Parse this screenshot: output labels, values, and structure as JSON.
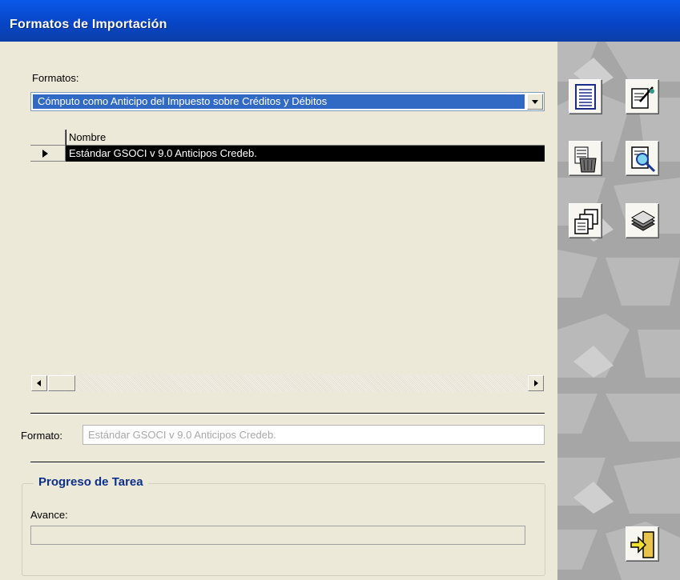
{
  "window": {
    "title": "Formatos de Importación"
  },
  "formatos": {
    "label": "Formatos:",
    "selected": "Cómputo como Anticipo del Impuesto sobre Créditos y Débitos"
  },
  "grid": {
    "column_header": "Nombre",
    "rows": [
      {
        "nombre": "Estándar GSOCI v 9.0 Anticipos Credeb."
      }
    ]
  },
  "formato": {
    "label": "Formato:",
    "value": "Estándar GSOCI v 9.0 Anticipos Credeb."
  },
  "progreso": {
    "title": "Progreso de Tarea",
    "avance_label": "Avance:",
    "value": 0
  },
  "toolbar": {
    "icons": [
      "document-icon",
      "edit-document-icon",
      "delete-icon",
      "preview-icon",
      "copy-icon",
      "stack-icon",
      "exit-icon"
    ]
  },
  "colors": {
    "title_bar": "#0a50d8",
    "selection": "#316ac5",
    "group_title": "#0d2f8c",
    "sidebar": "#a6a6a6"
  }
}
